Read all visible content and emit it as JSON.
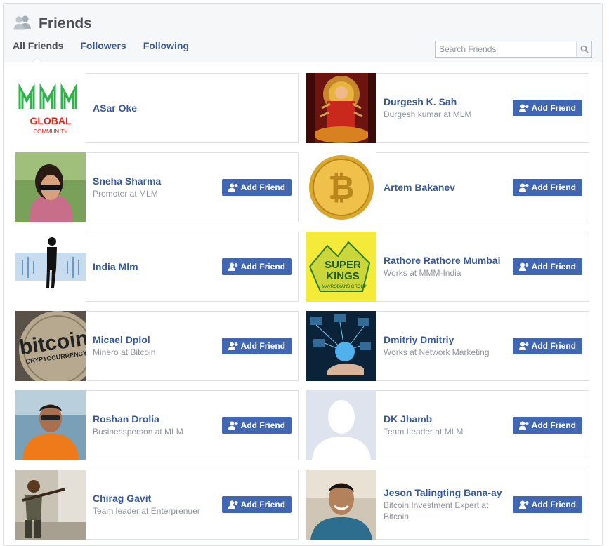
{
  "header": {
    "title": "Friends",
    "icon": "friends-icon"
  },
  "tabs": [
    {
      "label": "All Friends",
      "active": true
    },
    {
      "label": "Followers",
      "active": false
    },
    {
      "label": "Following",
      "active": false
    }
  ],
  "search": {
    "placeholder": "Search Friends",
    "value": "",
    "icon": "search-icon"
  },
  "add_friend_label": "Add Friend",
  "avatar_texts": {
    "global": "GLOBAL",
    "community": "COMMUNITY",
    "bitcoin": "bitcoin",
    "crypto": "CRYPTOCURRENCY",
    "super": "SUPER",
    "kings": "KINGS",
    "mavro": "MAVRODIANS GROUP"
  },
  "friends": [
    {
      "name": "ASar Oke",
      "subtitle": "",
      "avatar": "mmm-global-logo",
      "button": false
    },
    {
      "name": "Durgesh K. Sah",
      "subtitle": "Durgesh kumar at MLM",
      "avatar": "deity-image",
      "button": true
    },
    {
      "name": "Sneha Sharma",
      "subtitle": "Promoter at MLM",
      "avatar": "woman-photo",
      "button": true
    },
    {
      "name": "Artem Bakanev",
      "subtitle": "",
      "avatar": "bitcoin-coin",
      "button": true
    },
    {
      "name": "India Mlm",
      "subtitle": "",
      "avatar": "silhouette-figure",
      "button": true
    },
    {
      "name": "Rathore Rathore Mumbai",
      "subtitle": "Works at MMM-India",
      "avatar": "super-kings-logo",
      "button": true
    },
    {
      "name": "Micael Dplol",
      "subtitle": "Minero at Bitcoin",
      "avatar": "bitcoin-cryptocurrency",
      "button": true
    },
    {
      "name": "Dmitriy Dmitriy",
      "subtitle": "Works at Network Marketing",
      "avatar": "network-globe",
      "button": true
    },
    {
      "name": "Roshan Drolia",
      "subtitle": "Businessperson at MLM",
      "avatar": "man-lifejacket-photo",
      "button": true
    },
    {
      "name": "DK Jhamb",
      "subtitle": "Team Leader at MLM",
      "avatar": "default-profile",
      "button": true
    },
    {
      "name": "Chirag Gavit",
      "subtitle": "Team leader at Enterprenuer",
      "avatar": "man-rifle-photo",
      "button": true
    },
    {
      "name": "Jeson Talingting Bana-ay",
      "subtitle": "Bitcoin Investment Expert at Bitcoin",
      "avatar": "man-smiling-photo",
      "button": true
    }
  ],
  "colors": {
    "link": "#365899",
    "button": "#4267b2",
    "header_bg": "#f6f7f9",
    "border": "#dddfe2",
    "muted": "#90949c"
  }
}
